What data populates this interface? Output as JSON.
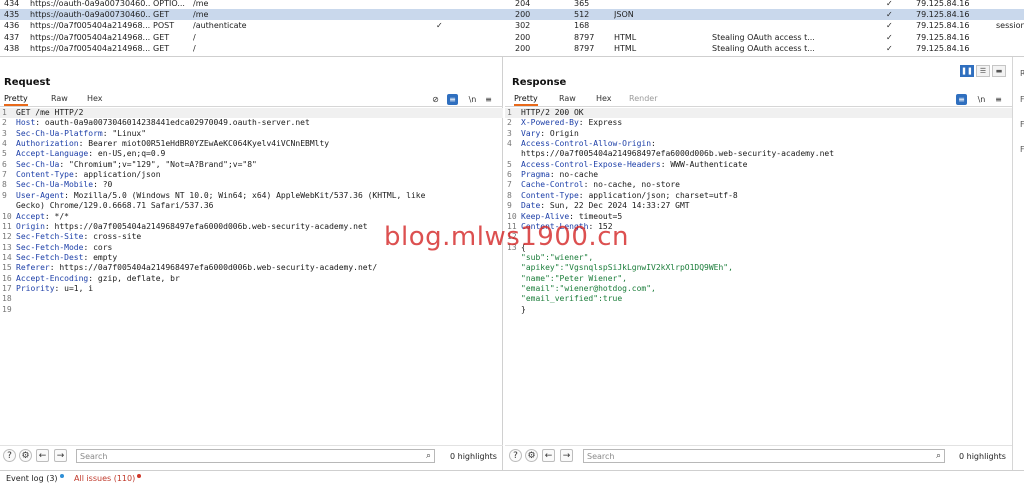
{
  "history": {
    "rows": [
      {
        "id": "434",
        "host": "https://oauth-0a9a00730460...",
        "method": "OPTIO...",
        "url": "/me",
        "param": "",
        "status": "204",
        "length": "365",
        "mime": "",
        "title": "",
        "tls": "✓",
        "ip": "79.125.84.16",
        "cookies": ""
      },
      {
        "id": "435",
        "host": "https://oauth-0a9a00730460...",
        "method": "GET",
        "url": "/me",
        "param": "",
        "status": "200",
        "length": "512",
        "mime": "JSON",
        "title": "",
        "tls": "✓",
        "ip": "79.125.84.16",
        "cookies": "",
        "selected": true
      },
      {
        "id": "436",
        "host": "https://0a7f005404a214968...",
        "method": "POST",
        "url": "/authenticate",
        "param": "✓",
        "status": "302",
        "length": "168",
        "mime": "",
        "title": "",
        "tls": "✓",
        "ip": "79.125.84.16",
        "cookies": "session"
      },
      {
        "id": "437",
        "host": "https://0a7f005404a214968...",
        "method": "GET",
        "url": "/",
        "param": "",
        "status": "200",
        "length": "8797",
        "mime": "HTML",
        "title": "Stealing OAuth access t...",
        "tls": "✓",
        "ip": "79.125.84.16",
        "cookies": ""
      },
      {
        "id": "438",
        "host": "https://0a7f005404a214968...",
        "method": "GET",
        "url": "/",
        "param": "",
        "status": "200",
        "length": "8797",
        "mime": "HTML",
        "title": "Stealing OAuth access t...",
        "tls": "✓",
        "ip": "79.125.84.16",
        "cookies": ""
      }
    ]
  },
  "request": {
    "title": "Request",
    "tabs": [
      "Pretty",
      "Raw",
      "Hex"
    ],
    "active_tab": "Pretty",
    "lines": [
      {
        "n": "1",
        "key": "",
        "text": "GET /me HTTP/2"
      },
      {
        "n": "2",
        "key": "Host",
        "text": " oauth-0a9a0073046014238441edca02970049.oauth-server.net"
      },
      {
        "n": "3",
        "key": "Sec-Ch-Ua-Platform",
        "text": " \"Linux\""
      },
      {
        "n": "4",
        "key": "Authorization",
        "text": " Bearer miotO0R51eHdBR0YZEwAeKC064Kyelv4iVCNnEBMlty"
      },
      {
        "n": "5",
        "key": "Accept-Language",
        "text": " en-US,en;q=0.9"
      },
      {
        "n": "6",
        "key": "Sec-Ch-Ua",
        "text": " \"Chromium\";v=\"129\", \"Not=A?Brand\";v=\"8\""
      },
      {
        "n": "7",
        "key": "Content-Type",
        "text": " application/json"
      },
      {
        "n": "8",
        "key": "Sec-Ch-Ua-Mobile",
        "text": " ?0"
      },
      {
        "n": "9",
        "key": "User-Agent",
        "text": " Mozilla/5.0 (Windows NT 10.0; Win64; x64) AppleWebKit/537.36 (KHTML, like"
      },
      {
        "n": "",
        "key": "",
        "text": "Gecko) Chrome/129.0.6668.71 Safari/537.36"
      },
      {
        "n": "10",
        "key": "Accept",
        "text": " */*"
      },
      {
        "n": "11",
        "key": "Origin",
        "text": " https://0a7f005404a214968497efa6000d006b.web-security-academy.net"
      },
      {
        "n": "12",
        "key": "Sec-Fetch-Site",
        "text": " cross-site"
      },
      {
        "n": "13",
        "key": "Sec-Fetch-Mode",
        "text": " cors"
      },
      {
        "n": "14",
        "key": "Sec-Fetch-Dest",
        "text": " empty"
      },
      {
        "n": "15",
        "key": "Referer",
        "text": " https://0a7f005404a214968497efa6000d006b.web-security-academy.net/"
      },
      {
        "n": "16",
        "key": "Accept-Encoding",
        "text": " gzip, deflate, br"
      },
      {
        "n": "17",
        "key": "Priority",
        "text": " u=1, i"
      },
      {
        "n": "18",
        "key": "",
        "text": ""
      },
      {
        "n": "19",
        "key": "",
        "text": ""
      }
    ],
    "search_placeholder": "Search",
    "highlights": "0 highlights"
  },
  "response": {
    "title": "Response",
    "tabs": [
      "Pretty",
      "Raw",
      "Hex",
      "Render"
    ],
    "active_tab": "Pretty",
    "lines": [
      {
        "n": "1",
        "key": "",
        "text": "HTTP/2 200 OK"
      },
      {
        "n": "2",
        "key": "X-Powered-By",
        "text": " Express"
      },
      {
        "n": "3",
        "key": "Vary",
        "text": " Origin"
      },
      {
        "n": "4",
        "key": "Access-Control-Allow-Origin",
        "text": ""
      },
      {
        "n": "",
        "key": "",
        "text": "https://0a7f005404a214968497efa6000d006b.web-security-academy.net"
      },
      {
        "n": "5",
        "key": "Access-Control-Expose-Headers",
        "text": " WWW-Authenticate"
      },
      {
        "n": "6",
        "key": "Pragma",
        "text": " no-cache"
      },
      {
        "n": "7",
        "key": "Cache-Control",
        "text": " no-cache, no-store"
      },
      {
        "n": "8",
        "key": "Content-Type",
        "text": " application/json; charset=utf-8"
      },
      {
        "n": "9",
        "key": "Date",
        "text": " Sun, 22 Dec 2024 14:33:27 GMT"
      },
      {
        "n": "10",
        "key": "Keep-Alive",
        "text": " timeout=5"
      },
      {
        "n": "11",
        "key": "Content-Length",
        "text": " 152"
      },
      {
        "n": "12",
        "key": "",
        "text": ""
      },
      {
        "n": "13",
        "key": "",
        "text": "{"
      },
      {
        "n": "",
        "key": "",
        "text": "  \"sub\":\"wiener\","
      },
      {
        "n": "",
        "key": "",
        "text": "  \"apikey\":\"VgsnqlspSiJkLgnwIV2kXlrpO1DQ9WEh\","
      },
      {
        "n": "",
        "key": "",
        "text": "  \"name\":\"Peter Wiener\","
      },
      {
        "n": "",
        "key": "",
        "text": "  \"email\":\"wiener@hotdog.com\","
      },
      {
        "n": "",
        "key": "",
        "text": "  \"email_verified\":true"
      },
      {
        "n": "",
        "key": "",
        "text": "}"
      }
    ],
    "search_placeholder": "Search",
    "highlights": "0 highlights"
  },
  "side_strip": {
    "items": [
      "R",
      "F",
      "F",
      "F"
    ]
  },
  "status_bar": {
    "event_log": "Event log (3)",
    "all_issues": "All issues (110)"
  },
  "watermark": "blog.mlws1900.cn",
  "colors": {
    "accent": "#e8691a",
    "selected_row": "#c9d8ec",
    "blue_button": "#2f6fbf",
    "issues_red": "#c0392b"
  }
}
